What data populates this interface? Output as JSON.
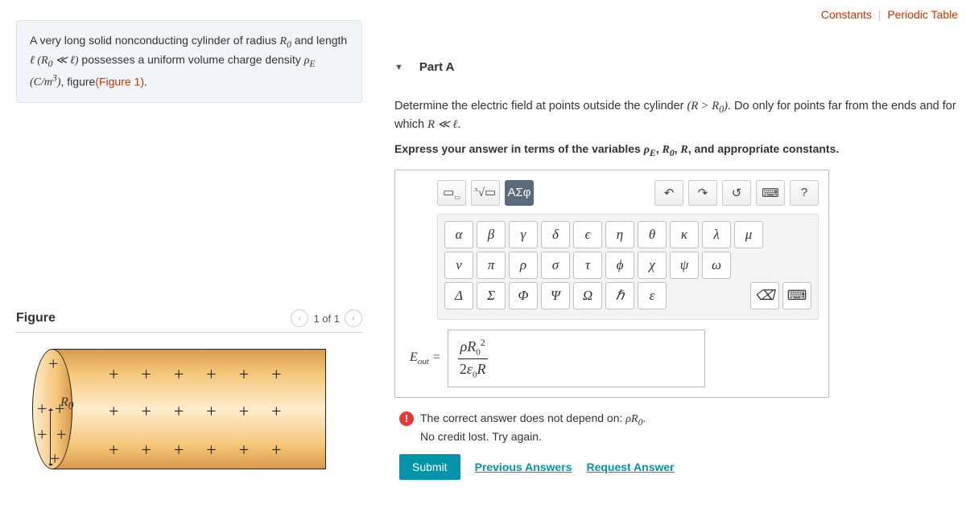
{
  "top_links": {
    "constants": "Constants",
    "periodic": "Periodic Table"
  },
  "intro": {
    "text_pre": "A very long solid nonconducting cylinder of radius ",
    "R0": "R₀",
    "text_2": " and length ",
    "ell": "ℓ",
    "cond": " (R₀ ≪ ℓ)",
    "text_3": " possesses a uniform volume charge density ",
    "rhoE": "ρE",
    "units": " (C/m³)",
    "text_4": ", figure",
    "fig_link": "(Figure 1)",
    "text_end": "."
  },
  "figure": {
    "heading": "Figure",
    "pager": "1 of 1",
    "r0_label": "R₀"
  },
  "part": {
    "label": "Part A",
    "prompt_1": "Determine the electric field at points outside the cylinder ",
    "prompt_cond": "(R > R₀)",
    "prompt_2": ". Do only for points far from the ends and for which ",
    "prompt_cond2": "R ≪ ℓ",
    "prompt_3": ".",
    "hint": "Express your answer in terms of the variables ρE, R₀, R, and appropriate constants."
  },
  "toolbar": {
    "templates": "▭",
    "sqrt": "√▭",
    "greek": "ΑΣφ",
    "undo": "↶",
    "redo": "↷",
    "reset": "↺",
    "keyboard": "⌨",
    "help": "?"
  },
  "greek": {
    "row1": [
      "α",
      "β",
      "γ",
      "δ",
      "ϵ",
      "η",
      "θ",
      "κ",
      "λ",
      "μ"
    ],
    "row2": [
      "ν",
      "π",
      "ρ",
      "σ",
      "τ",
      "ϕ",
      "χ",
      "ψ",
      "ω"
    ],
    "row3": [
      "Δ",
      "Σ",
      "Φ",
      "Ψ",
      "Ω",
      "ℏ",
      "ε"
    ],
    "close": "⌫",
    "kbd": "⌨"
  },
  "answer": {
    "lhs": "Eout =",
    "num_html": "ρR₀²",
    "den_html": "2ε₀R"
  },
  "feedback": {
    "line1": "The correct answer does not depend on: ρR₀.",
    "line2": "No credit lost. Try again."
  },
  "actions": {
    "submit": "Submit",
    "previous": "Previous Answers",
    "request": "Request Answer"
  }
}
